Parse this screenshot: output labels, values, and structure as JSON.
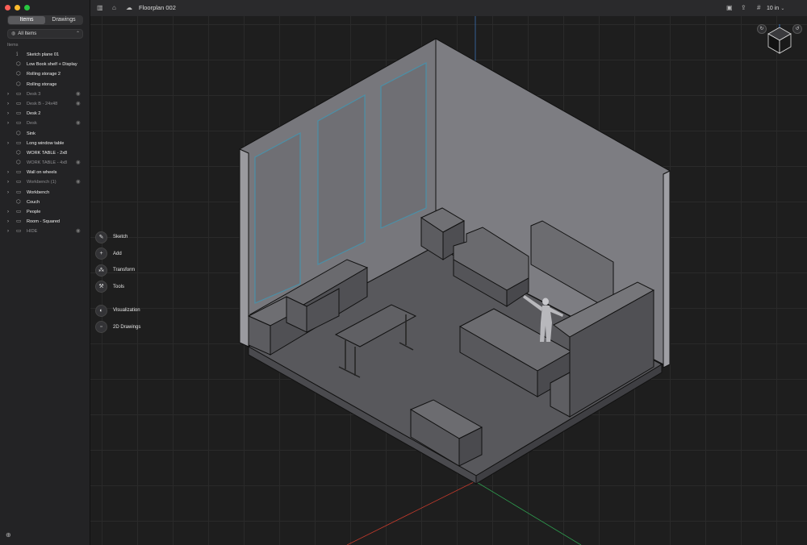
{
  "sidebar": {
    "tabs": [
      {
        "label": "Items",
        "active": true
      },
      {
        "label": "Drawings",
        "active": false
      }
    ],
    "filter": {
      "label": "All Items"
    },
    "section_label": "Items",
    "items": [
      {
        "label": "Sketch plane 01",
        "icon": "sketch-plane-icon",
        "expandable": false,
        "dim": false,
        "hidden": false
      },
      {
        "label": "Low Book shelf + Display",
        "icon": "cube-icon",
        "expandable": false,
        "dim": false,
        "hidden": false
      },
      {
        "label": "Rolling storage 2",
        "icon": "cube-icon",
        "expandable": false,
        "dim": false,
        "hidden": false
      },
      {
        "label": "Rolling storage",
        "icon": "cube-icon",
        "expandable": false,
        "dim": false,
        "hidden": false
      },
      {
        "label": "Desk 3",
        "icon": "folder-icon",
        "expandable": true,
        "dim": true,
        "hidden": true
      },
      {
        "label": "Desk B - 24x48",
        "icon": "folder-icon",
        "expandable": true,
        "dim": true,
        "hidden": true
      },
      {
        "label": "Desk 2",
        "icon": "folder-icon",
        "expandable": true,
        "dim": false,
        "hidden": false
      },
      {
        "label": "Desk",
        "icon": "folder-icon",
        "expandable": true,
        "dim": true,
        "hidden": true
      },
      {
        "label": "Sink",
        "icon": "cube-icon",
        "expandable": false,
        "dim": false,
        "hidden": false
      },
      {
        "label": "Long window table",
        "icon": "folder-icon",
        "expandable": true,
        "dim": false,
        "hidden": false
      },
      {
        "label": "WORK TABLE - 2x8",
        "icon": "cube-icon",
        "expandable": false,
        "dim": false,
        "hidden": false
      },
      {
        "label": "WORK TABLE - 4x8",
        "icon": "cube-icon",
        "expandable": false,
        "dim": true,
        "hidden": true
      },
      {
        "label": "Wall on wheels",
        "icon": "folder-icon",
        "expandable": true,
        "dim": false,
        "hidden": false
      },
      {
        "label": "Workbench (1)",
        "icon": "folder-icon",
        "expandable": true,
        "dim": true,
        "hidden": true
      },
      {
        "label": "Workbench",
        "icon": "folder-icon",
        "expandable": true,
        "dim": false,
        "hidden": false
      },
      {
        "label": "Couch",
        "icon": "cube-icon",
        "expandable": false,
        "dim": false,
        "hidden": false
      },
      {
        "label": "People",
        "icon": "folder-icon",
        "expandable": true,
        "dim": false,
        "hidden": false
      },
      {
        "label": "Room - Squared",
        "icon": "folder-icon",
        "expandable": true,
        "dim": false,
        "hidden": false
      },
      {
        "label": "HIDE",
        "icon": "folder-icon",
        "expandable": true,
        "dim": true,
        "hidden": true
      }
    ]
  },
  "toolbar": {
    "title": "Floorplan 002",
    "unit": "10 in"
  },
  "tools": [
    {
      "label": "Sketch",
      "icon": "pencil-icon"
    },
    {
      "label": "Add",
      "icon": "plus-icon"
    },
    {
      "label": "Transform",
      "icon": "transform-icon"
    },
    {
      "label": "Tools",
      "icon": "wrench-icon"
    },
    {
      "label": "Visualization",
      "icon": "visualization-icon"
    },
    {
      "label": "2D Drawings",
      "icon": "drawing-icon"
    }
  ],
  "colors": {
    "background": "#1e1e1e",
    "sidebar": "#232325",
    "wall": "#7a7a7f",
    "window_outline": "#4a90a8",
    "axis_x": "#c0392b",
    "axis_y": "#2e9e4f",
    "axis_z": "#3a6fb0"
  }
}
